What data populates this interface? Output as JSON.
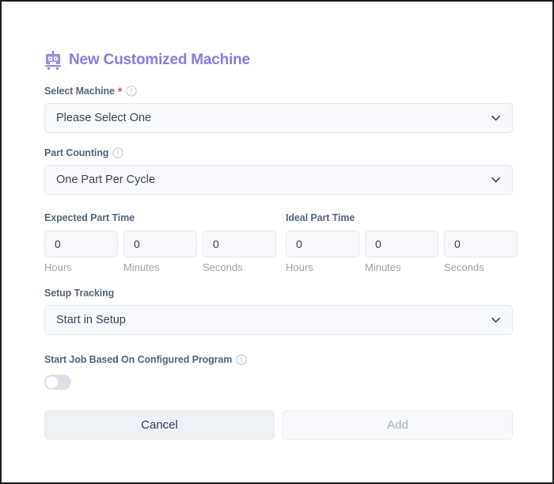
{
  "window": {
    "border_color": "#1c1c1e",
    "background": "#ffffff"
  },
  "form": {
    "title": "New Customized Machine",
    "title_icon": "robot-icon",
    "title_color": "#8b7ae0",
    "fields": {
      "select_machine": {
        "label": "Select Machine",
        "required_marker": "*",
        "info_icon": "info-circle-icon",
        "value": "Please Select One",
        "chevron_icon": "chevron-down-icon"
      },
      "part_counting": {
        "label": "Part Counting",
        "info_icon": "info-circle-icon",
        "value": "One Part Per Cycle",
        "chevron_icon": "chevron-down-icon"
      },
      "expected_part_time": {
        "label": "Expected Part Time",
        "units": [
          {
            "unit": "Hours",
            "value": "0"
          },
          {
            "unit": "Minutes",
            "value": "0"
          },
          {
            "unit": "Seconds",
            "value": "0"
          }
        ]
      },
      "ideal_part_time": {
        "label": "Ideal Part Time",
        "units": [
          {
            "unit": "Hours",
            "value": "0"
          },
          {
            "unit": "Minutes",
            "value": "0"
          },
          {
            "unit": "Seconds",
            "value": "0"
          }
        ]
      },
      "setup_tracking": {
        "label": "Setup Tracking",
        "value": "Start in Setup",
        "chevron_icon": "chevron-down-icon"
      },
      "start_job_program": {
        "label": "Start Job Based On Configured Program",
        "info_icon": "info-circle-icon",
        "toggle_state": "off"
      }
    },
    "actions": {
      "cancel_label": "Cancel",
      "add_label": "Add",
      "add_disabled": true
    }
  },
  "colors": {
    "accent": "#8b7ae0",
    "label": "#56657e",
    "required": "#e0484b",
    "field_bg": "#f7f9fc",
    "field_border": "#e3e8f0",
    "value_text": "#3b465c",
    "muted": "#9aa3b4",
    "toggle_track": "#dbe2ec"
  }
}
